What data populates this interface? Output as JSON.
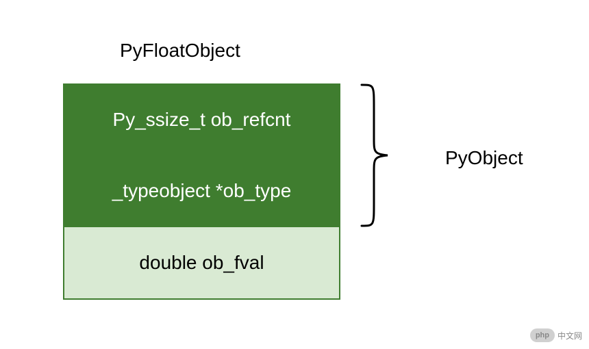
{
  "title": "PyFloatObject",
  "rows": [
    {
      "label": "Py_ssize_t ob_refcnt",
      "style": "green"
    },
    {
      "label": "_typeobject *ob_type",
      "style": "green"
    },
    {
      "label": "double ob_fval",
      "style": "light"
    }
  ],
  "groupLabel": "PyObject",
  "watermark": {
    "badge": "php",
    "text": "中文网"
  }
}
